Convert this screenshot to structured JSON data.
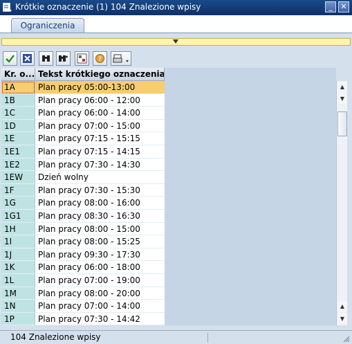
{
  "window": {
    "title": "Krótkie oznaczenie (1)  104 Znalezione wpisy",
    "minimize_glyph": "_",
    "close_glyph": "✕"
  },
  "tabs": [
    {
      "label": "Ograniczenia"
    }
  ],
  "toolbar": {
    "buttons": [
      {
        "icon": "checkmark-icon"
      },
      {
        "icon": "cancel-icon"
      },
      {
        "icon": "find-icon"
      },
      {
        "icon": "find-next-icon"
      },
      {
        "icon": "filter-icon"
      },
      {
        "icon": "help-icon"
      },
      {
        "icon": "print-icon"
      }
    ]
  },
  "table": {
    "columns": [
      "Kr. o...",
      "Tekst krótkiego oznaczenia"
    ],
    "rows": [
      {
        "key": "1A",
        "text": "Plan pracy 05:00-13:00"
      },
      {
        "key": "1B",
        "text": "Plan pracy 06:00 - 12:00"
      },
      {
        "key": "1C",
        "text": "Plan pracy 06:00 - 14:00"
      },
      {
        "key": "1D",
        "text": "Plan pracy 07:00 - 15:00"
      },
      {
        "key": "1E",
        "text": "Plan pracy 07:15 - 15:15"
      },
      {
        "key": "1E1",
        "text": "Plan pracy 07:15 - 14:15"
      },
      {
        "key": "1E2",
        "text": "Plan pracy 07:30 - 14:30"
      },
      {
        "key": "1EW",
        "text": "Dzień wolny"
      },
      {
        "key": "1F",
        "text": "Plan pracy 07:30 - 15:30"
      },
      {
        "key": "1G",
        "text": "Plan pracy 08:00 - 16:00"
      },
      {
        "key": "1G1",
        "text": "Plan pracy 08:30 - 16:30"
      },
      {
        "key": "1H",
        "text": "Plan pracy 08:00 - 15:00"
      },
      {
        "key": "1I",
        "text": "Plan pracy 08:00 - 15:25"
      },
      {
        "key": "1J",
        "text": "Plan pracy 09:30 - 17:30"
      },
      {
        "key": "1K",
        "text": "Plan pracy 06:00 - 18:00"
      },
      {
        "key": "1L",
        "text": "Plan pracy 07:00 - 19:00"
      },
      {
        "key": "1M",
        "text": "Plan pracy 08:00 - 20:00"
      },
      {
        "key": "1N",
        "text": "Plan pracy 07:00 - 14:00"
      },
      {
        "key": "1P",
        "text": "Plan pracy 07:30 - 14:42"
      }
    ],
    "selected_index": 0
  },
  "status": {
    "message": "104 Znalezione wpisy"
  }
}
